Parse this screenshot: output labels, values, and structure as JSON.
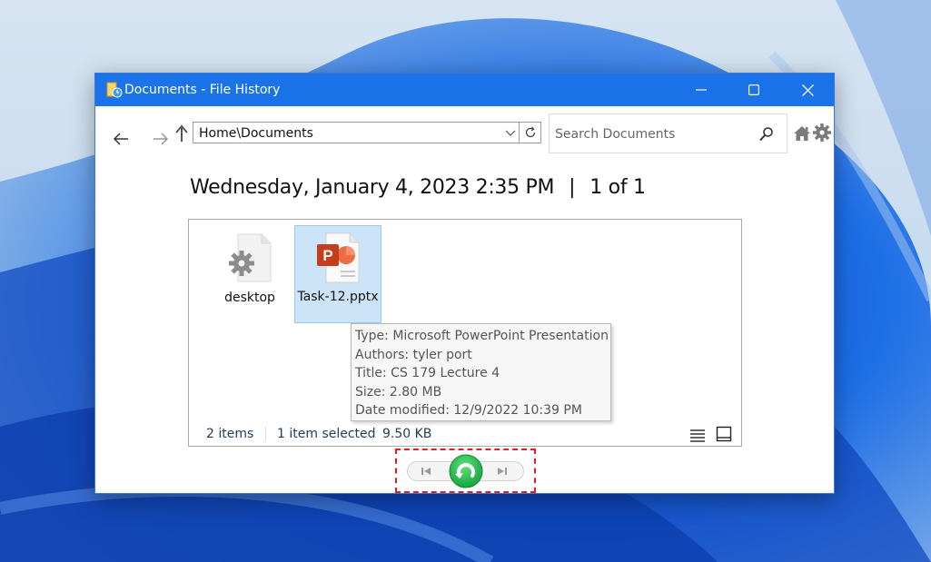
{
  "window": {
    "title": "Documents - File History"
  },
  "toolbar": {
    "address_path": "Home\\Documents",
    "search_placeholder": "Search Documents"
  },
  "header": {
    "date": "Wednesday, January 4, 2023 2:35 PM",
    "separator": "|",
    "position": "1 of 1"
  },
  "files": [
    {
      "name": "desktop",
      "icon": "settings-file-icon",
      "selected": false
    },
    {
      "name": "Task-12.pptx",
      "icon": "powerpoint-file-icon",
      "selected": true
    }
  ],
  "tooltip": {
    "type": "Type: Microsoft PowerPoint Presentation",
    "authors": "Authors: tyler port",
    "title": "Title: CS 179 Lecture 4",
    "size": "Size: 2.80 MB",
    "date_modified": "Date modified: 12/9/2022 10:39 PM"
  },
  "status": {
    "item_count": "2 items",
    "selected": "1 item selected",
    "selected_size": "9.50 KB"
  },
  "colors": {
    "titlebar": "#1a73e8",
    "selection": "#cce4f7",
    "restore_button": "#22b14c",
    "highlight": "#e02020"
  }
}
